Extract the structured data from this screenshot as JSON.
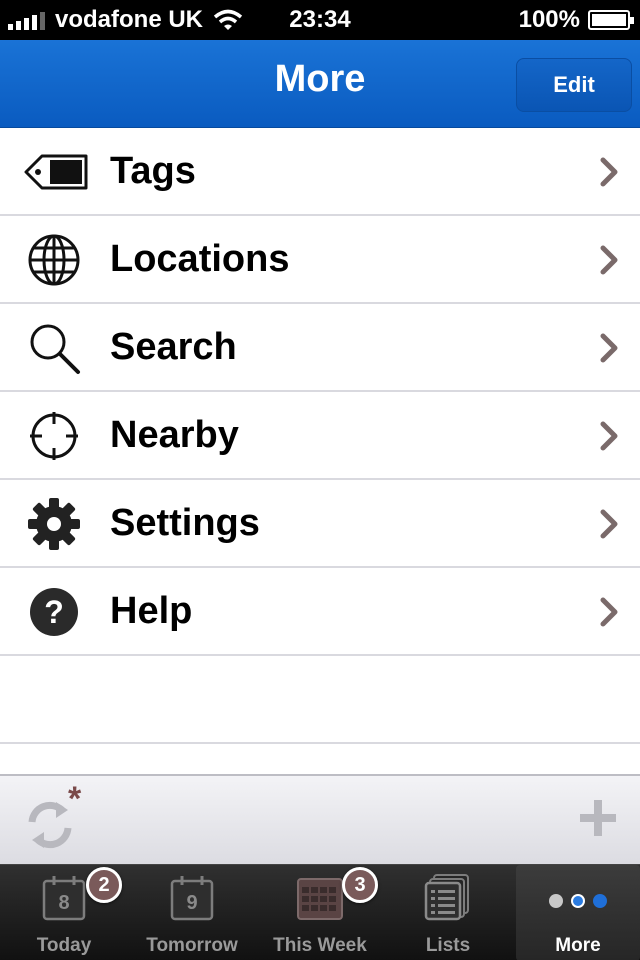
{
  "status_bar": {
    "carrier": "vodafone UK",
    "time": "23:34",
    "battery": "100%"
  },
  "nav": {
    "title": "More",
    "edit_label": "Edit"
  },
  "menu": {
    "items": [
      {
        "label": "Tags",
        "icon": "tag-icon"
      },
      {
        "label": "Locations",
        "icon": "globe-icon"
      },
      {
        "label": "Search",
        "icon": "search-icon"
      },
      {
        "label": "Nearby",
        "icon": "crosshair-icon"
      },
      {
        "label": "Settings",
        "icon": "gear-icon"
      },
      {
        "label": "Help",
        "icon": "help-icon"
      }
    ]
  },
  "toolbar": {
    "sync_icon": "sync-icon",
    "add_icon": "plus-icon"
  },
  "tabs": {
    "items": [
      {
        "label": "Today",
        "icon_number": "8",
        "badge": "2"
      },
      {
        "label": "Tomorrow",
        "icon_number": "9"
      },
      {
        "label": "This Week",
        "badge": "3"
      },
      {
        "label": "Lists"
      },
      {
        "label": "More",
        "active": true
      }
    ]
  },
  "colors": {
    "nav_blue": "#0a5bc0",
    "chevron": "#7a6a6a",
    "badge": "#7a5a5a"
  }
}
